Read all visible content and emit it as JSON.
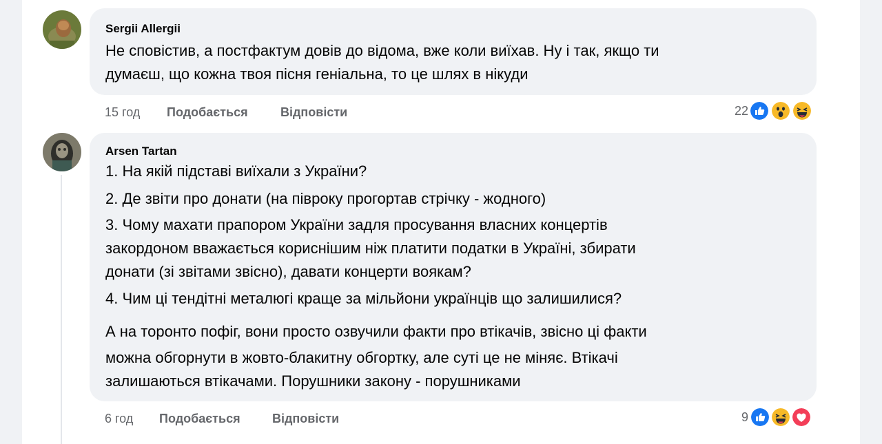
{
  "comments": [
    {
      "author": "Sergii Allergii",
      "lines": [
        "Не сповістив, а постфактум довів до відома, вже коли виїхав. Ну і так, якщо ти",
        "думаєш, що кожна твоя пісня геніальна, то це шлях в нікуди"
      ],
      "time": "15 год",
      "like_label": "Подобається",
      "reply_label": "Відповісти",
      "reaction_count": "22",
      "reactions": [
        "like-icon",
        "wow-icon",
        "haha-icon"
      ]
    },
    {
      "author": "Arsen Tartan",
      "lines": [
        "1. На якій підставі виїхали з України?",
        "2. Де звіти про донати (на півроку прогортав стрічку - жодного)",
        "3. Чому махати прапором України задля просування власних концертів",
        "закордоном вважається кориснішим ніж платити податки в Україні, збирати",
        "донати (зі звітами звісно), давати концерти воякам?",
        "4. Чим ці тендітні металюгі краще за мільйони українців що залишилися?"
      ],
      "paragraph2": [
        "А на торонто пофіг, вони просто озвучили факти про втікачів, звісно ці факти",
        "можна обгорнути в жовто-блакитну обгортку, але суті це не міняє. Втікачі",
        "залишаються втікачами. Порушники закону - порушниками"
      ],
      "time": "6 год",
      "like_label": "Подобається",
      "reply_label": "Відповісти",
      "reaction_count": "9",
      "reactions": [
        "like-icon",
        "haha-icon",
        "love-icon"
      ]
    }
  ],
  "colors": {
    "bubble": "#f0f2f5",
    "secondary_text": "#65676b",
    "like_blue": "#1877f2",
    "reaction_yellow": "#f7b928",
    "love_red": "#f33e58"
  }
}
